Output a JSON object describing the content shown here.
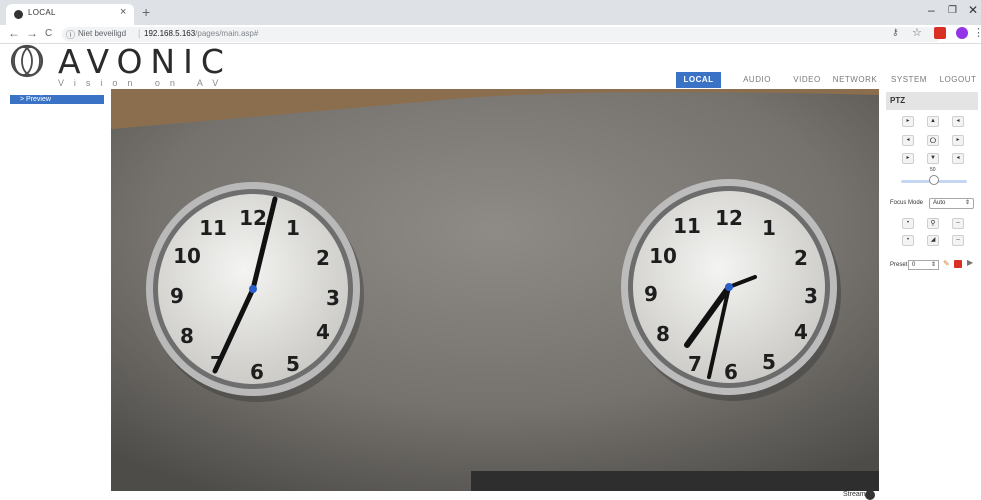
{
  "browser": {
    "tab_title": "LOCAL",
    "tab_close": "×",
    "new_tab": "+",
    "win_min": "–",
    "win_max": "❐",
    "win_close": "✕",
    "back": "←",
    "forward": "→",
    "reload": "C",
    "security_text": "Niet beveiligd",
    "url_sep": "|",
    "url_host": "192.168.5.163",
    "url_path": "/pages/main.asp#"
  },
  "logo": {
    "name": "AVONIC",
    "tagline": "Vision on AV"
  },
  "nav": {
    "items": [
      {
        "label": "LOCAL",
        "active": true
      },
      {
        "label": "AUDIO",
        "active": false
      },
      {
        "label": "VIDEO",
        "active": false
      },
      {
        "label": "NETWORK",
        "active": false
      },
      {
        "label": "SYSTEM",
        "active": false
      },
      {
        "label": "LOGOUT",
        "active": false
      }
    ]
  },
  "sidebar": {
    "preview_label": "> Preview"
  },
  "video": {
    "stream_label": "Stream"
  },
  "ptz": {
    "title": "PTZ",
    "speed_value": "50",
    "speed_fraction": 0.5,
    "focus_mode_label": "Focus Mode",
    "focus_mode_value": "Auto",
    "preset_label": "Preset",
    "preset_value": "0"
  }
}
